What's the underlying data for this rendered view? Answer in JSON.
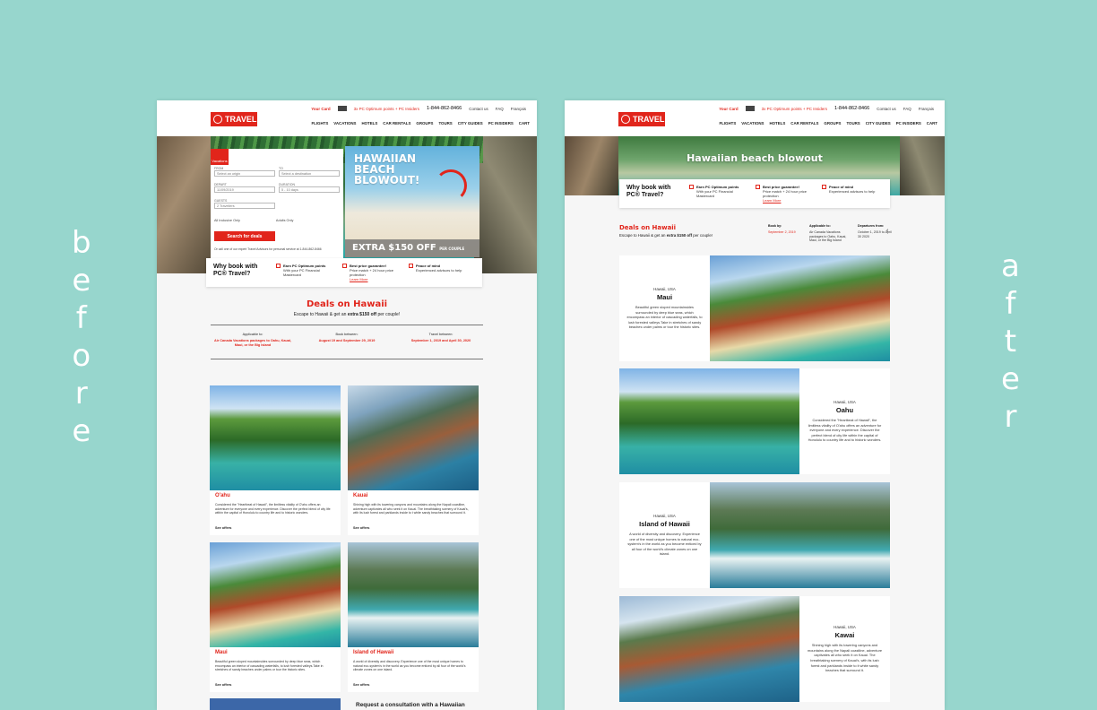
{
  "labels": {
    "before": "before",
    "after": "after"
  },
  "header": {
    "your_card": "Your Card",
    "points": "3x PC Optimum points + PC Insiders",
    "phone": "1-844-862-8466",
    "contact": "Contact us",
    "faq": "FAQ",
    "lang": "Français",
    "logo": "TRAVEL",
    "nav": [
      "FLIGHTS",
      "VACATIONS",
      "HOTELS",
      "CAR RENTALS",
      "GROUPS",
      "TOURS",
      "CITY GUIDES",
      "PC INSIDERS",
      "CART"
    ]
  },
  "search": {
    "tab": "Vacations",
    "from_label": "FROM",
    "from_placeholder": "Select an origin",
    "to_label": "TO",
    "to_placeholder": "Select a destination",
    "depart_label": "DEPART",
    "depart_value": "11/09/2019",
    "duration_label": "DURATION",
    "duration_value": "5 - 10 days",
    "guests_label": "GUESTS",
    "guests_value": "2 Travellers",
    "all_inclusive": "All Inclusive Only",
    "adults_only": "Adults Only",
    "button": "Search for deals",
    "phone_note": "Or call one of our expert Travel Advisors for personal service at 1-844-862-8466"
  },
  "promo": {
    "title_1": "HAWAIIAN",
    "title_2": "BEACH",
    "title_3": "BLOWOUT!",
    "offer": "EXTRA $150 OFF",
    "per": "PER COUPLE"
  },
  "why": {
    "title": "Why book with PC® Travel?",
    "items": [
      {
        "title": "Earn PC Optimum points",
        "text": "With your PC Financial Mastercard",
        "link": ""
      },
      {
        "title": "Best price guarantee!",
        "text": "Price match + 24 hour price protection",
        "link": "Learn More"
      },
      {
        "title": "Peace of mind",
        "text": "Experienced advisors to help",
        "link": ""
      }
    ]
  },
  "deals": {
    "title": "Deals on Hawaii",
    "subtitle_pre": "Escape to Hawaii & get an ",
    "subtitle_bold": "extra $150 off",
    "subtitle_post": " per couple!",
    "applicable_label": "Applicable to:",
    "applicable_value": "Air Canada Vacations packages to Oahu, Kauai, Maui, or the Big Island",
    "book_label": "Book between:",
    "book_value": "August 19 and September 29, 2019",
    "travel_label": "Travel between:",
    "travel_value": "September 1, 2019 and April 30, 2020"
  },
  "cards": [
    {
      "name": "O'ahu",
      "desc": "Considered the \"Heartbeat of Hawaii\", the limitless vitality of O'ahu offers an adventure for everyone and every experience. Discover the perfect blend of city life within the capital of Honolulu to country life and to historic wonders.",
      "cta": "See offers"
    },
    {
      "name": "Kauai",
      "desc": "Shining high with its towering canyons and mountains along the Napali coastline, adventure captivates all who seek it on Kauai. The breathtaking scenery of Kauai's, with its lush forest and parklands inside to t white sandy beaches that surround it.",
      "cta": "See offers"
    },
    {
      "name": "Maui",
      "desc": "Beautiful green sloped mountainsides surrounded by deep blue seas, which encompass an interior of cascading waterfalls, to lush forested valleys.Take in stretches of sandy beaches under palms or tour the historic sites.",
      "cta": "See offers"
    },
    {
      "name": "Island of Hawaii",
      "desc": "A world of diversity and discovery. Experience one of the most unique homes to natural eco-system's in the world as you become enticed by all four of the world's climate zones on one island.",
      "cta": "See offers"
    }
  ],
  "consult": "Request a consultation with a Hawaiian",
  "after": {
    "banner": "Hawaiian beach blowout",
    "deals_book_label": "Book by:",
    "deals_book_value": "September 2, 2019",
    "deals_applicable_label": "Applicable to:",
    "deals_applicable_value": "Air Canada Vacations packages to Oahu, Kauai, Maui, or the Big Island",
    "deals_depart_label": "Departures from:",
    "deals_depart_value": "October 1, 2019 to April 30 2020",
    "location": "Hawaii, USA",
    "islands": [
      {
        "name": "Maui",
        "desc": "Beautiful green sloped mountainsides surrounded by deep blue seas, which encompass an interior of cascading waterfalls, to lush forested valleys.Take in stretches of sandy beaches under palms or tour the historic sites."
      },
      {
        "name": "Oahu",
        "desc": "Considered the \"Heartbeat of Hawaii\", the limitless vitality of O'ahu offers an adventure for everyone and every experience. Discover the perfect blend of city life within the capital of Honolulu to country life and to historic wonders."
      },
      {
        "name": "Island of Hawaii",
        "desc": "A world of diversity and discovery. Experience one of the most unique homes to natural eco-system's in the world as you become enticed by all four of the world's climate zones on one island."
      },
      {
        "name": "Kawai",
        "desc": "Shining high with its towering canyons and mountains along the Napali coastline, adventure captivates all who seek it on Kauai. The breathtaking scenery of Kauai's, with its lush forest and parklands inside to it white sandy beaches that surround it."
      }
    ]
  },
  "colors": {
    "background": "#97d6cd",
    "brand_red": "#e1251b",
    "page": "#f6f6f6"
  }
}
